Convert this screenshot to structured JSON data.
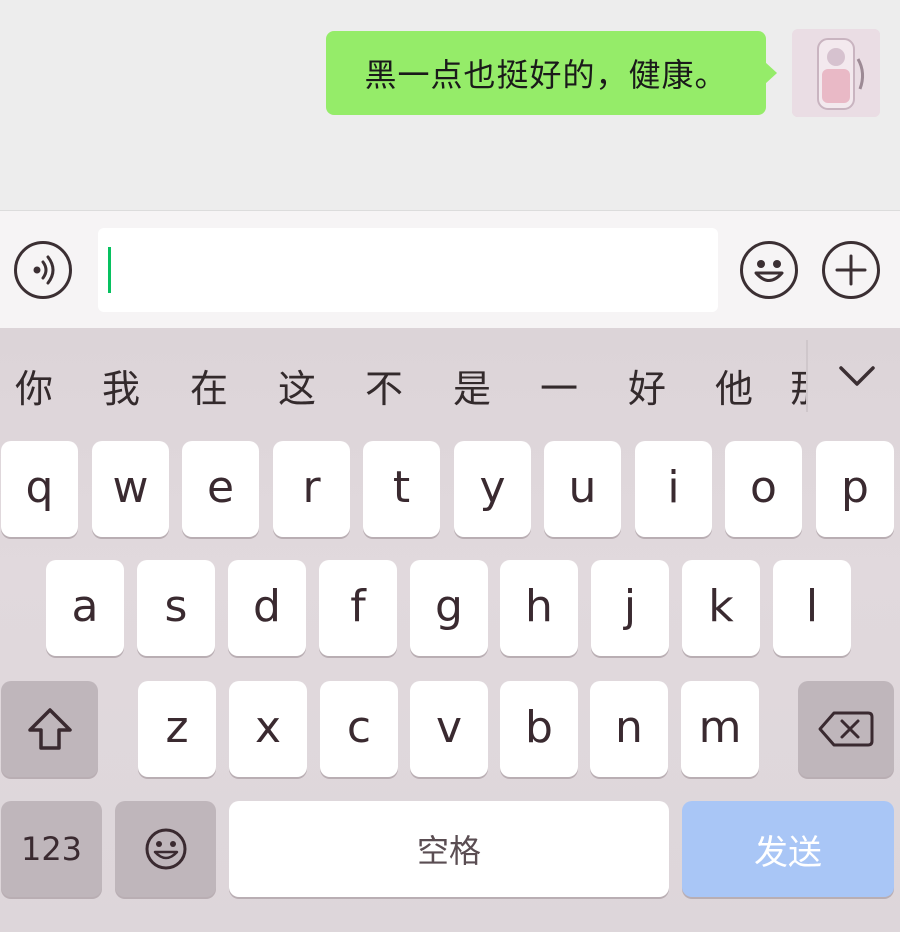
{
  "chat": {
    "message": "黑一点也挺好的，健康。"
  },
  "input_bar": {
    "input_value": ""
  },
  "keyboard": {
    "candidates": [
      "你",
      "我",
      "在",
      "这",
      "不",
      "是",
      "一",
      "好",
      "他",
      "那"
    ],
    "row1": [
      "q",
      "w",
      "e",
      "r",
      "t",
      "y",
      "u",
      "i",
      "o",
      "p"
    ],
    "row2": [
      "a",
      "s",
      "d",
      "f",
      "g",
      "h",
      "j",
      "k",
      "l"
    ],
    "row3": [
      "z",
      "x",
      "c",
      "v",
      "b",
      "n",
      "m"
    ],
    "numbers_label": "123",
    "space_label": "空格",
    "send_label": "发送"
  },
  "colors": {
    "bubble": "#95ec69",
    "caret": "#07c160",
    "send_key": "#a9c6f6"
  }
}
